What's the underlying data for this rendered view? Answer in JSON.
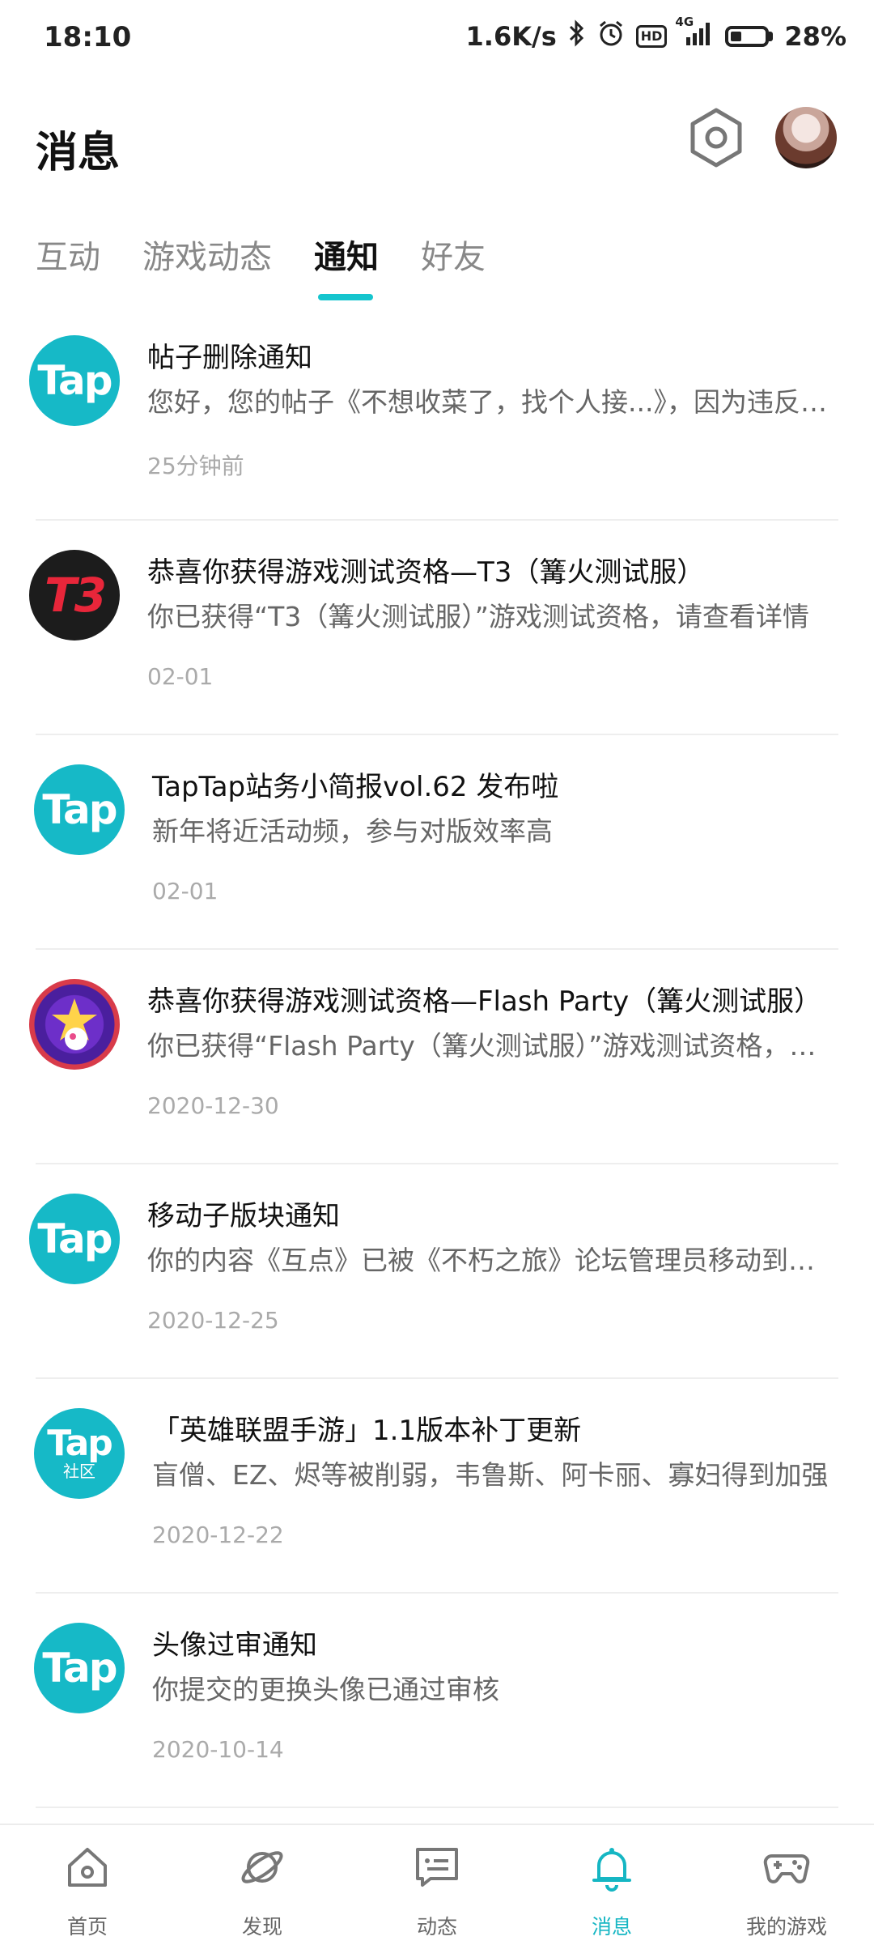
{
  "status_bar": {
    "time": "18:10",
    "net_speed": "1.6K/s",
    "network": "4G",
    "hd_badge": "HD",
    "battery_percent": "28%",
    "battery_level": 0.28,
    "icons": [
      "bluetooth-icon",
      "alarm-icon",
      "hd-icon",
      "signal-icon",
      "battery-icon"
    ]
  },
  "header": {
    "title": "消息",
    "settings_icon": "settings-hexagon-icon",
    "avatar_icon": "user-avatar"
  },
  "tabs": {
    "items": [
      {
        "label": "互动"
      },
      {
        "label": "游戏动态"
      },
      {
        "label": "通知"
      },
      {
        "label": "好友"
      }
    ],
    "active": "通知",
    "accent_color": "#15c5ce"
  },
  "notifications": [
    {
      "icon": "taptap-logo-icon",
      "icon_text": "Tap",
      "title": "帖子删除通知",
      "desc": "您好，您的帖子《不想收菜了，找个人接...》，因为违反社区规定已被删除",
      "time": "25分钟前"
    },
    {
      "icon": "t3-game-icon",
      "icon_text": "T3",
      "title": "恭喜你获得游戏测试资格—T3（篝火测试服）",
      "desc": "你已获得“T3（篝火测试服）”游戏测试资格，请查看详情",
      "time": "02-01"
    },
    {
      "icon": "taptap-logo-icon",
      "icon_text": "Tap",
      "title": "TapTap站务小简报vol.62 发布啦",
      "desc": "新年将近活动频，参与对版效率高",
      "time": "02-01"
    },
    {
      "icon": "flash-party-game-icon",
      "icon_text": "",
      "title": "恭喜你获得游戏测试资格—Flash Party（篝火测试服）",
      "desc": "你已获得“Flash Party（篝火测试服）”游戏测试资格，请查看详情",
      "time": "2020-12-30"
    },
    {
      "icon": "taptap-logo-icon",
      "icon_text": "Tap",
      "title": "移动子版块通知",
      "desc": "你的内容《互点》已被《不朽之旅》论坛管理员移动到其他版块",
      "time": "2020-12-25"
    },
    {
      "icon": "taptap-community-icon",
      "icon_text": "Tap",
      "icon_subtext": "社区",
      "title": "「英雄联盟手游」1.1版本补丁更新",
      "desc": "盲僧、EZ、烬等被削弱，韦鲁斯、阿卡丽、寡妇得到加强",
      "time": "2020-12-22"
    },
    {
      "icon": "taptap-logo-icon",
      "icon_text": "Tap",
      "title": "头像过审通知",
      "desc": "你提交的更换头像已通过审核",
      "time": "2020-10-14"
    }
  ],
  "bottom_nav": {
    "items": [
      {
        "label": "首页",
        "icon": "home-icon"
      },
      {
        "label": "发现",
        "icon": "discover-planet-icon"
      },
      {
        "label": "动态",
        "icon": "feed-chat-icon"
      },
      {
        "label": "消息",
        "icon": "bell-icon"
      },
      {
        "label": "我的游戏",
        "icon": "gamepad-icon"
      }
    ],
    "active": "消息",
    "active_color": "#15b6c3"
  }
}
